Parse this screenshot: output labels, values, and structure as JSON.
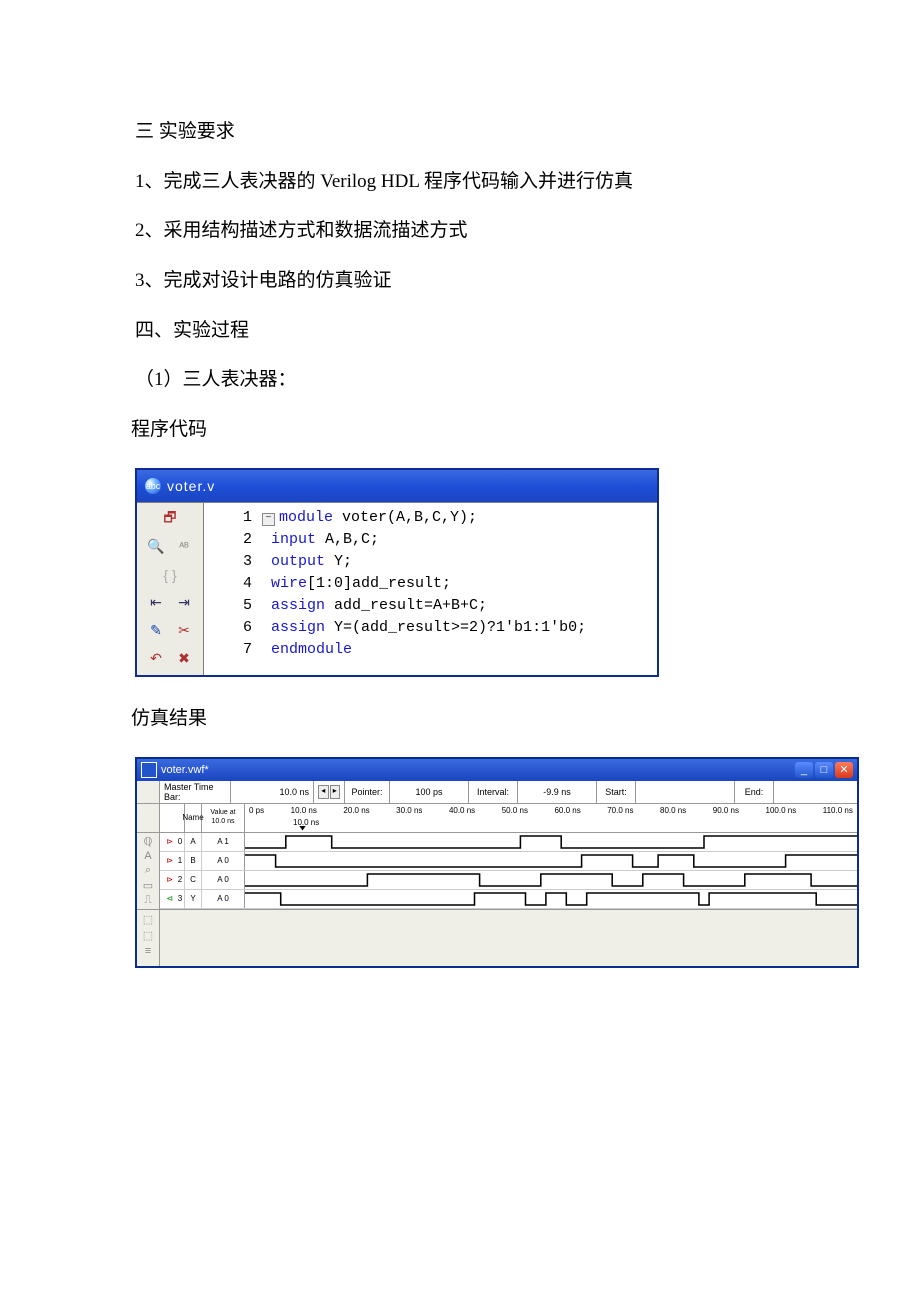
{
  "text": {
    "h_req": "三 实验要求",
    "req1": "1、完成三人表决器的 Verilog HDL 程序代码输入并进行仿真",
    "req2": "2、采用结构描述方式和数据流描述方式",
    "req3": "3、完成对设计电路的仿真验证",
    "h_proc": "四、实验过程",
    "proc1": "（1）三人表决器：",
    "code_label": "程序代码",
    "sim_label": "仿真结果"
  },
  "code_window": {
    "title": "voter.v",
    "icon_text": "abc",
    "lines": [
      {
        "n": "1",
        "kw": "module",
        "rest": " voter(A,B,C,Y);",
        "collapse": true
      },
      {
        "n": "2",
        "kw": "input",
        "rest": " A,B,C;"
      },
      {
        "n": "3",
        "kw": "output",
        "rest": " Y;"
      },
      {
        "n": "4",
        "kw": "wire",
        "rest": "[1:0]add_result;"
      },
      {
        "n": "5",
        "kw": "assign",
        "rest": " add_result=A+B+C;"
      },
      {
        "n": "6",
        "kw": "assign",
        "rest": " Y=(add_result>=2)?1'b1:1'b0;"
      },
      {
        "n": "7",
        "kw": "endmodule",
        "rest": ""
      }
    ]
  },
  "sim_window": {
    "title": "voter.vwf*",
    "toolbar": {
      "master_label": "Master Time Bar:",
      "master_value": "10.0 ns",
      "pointer_label": "Pointer:",
      "pointer_value": "100 ps",
      "interval_label": "Interval:",
      "interval_value": "-9.9 ns",
      "start_label": "Start:",
      "end_label": "End:"
    },
    "header": {
      "name": "Name",
      "value_at": "Value at",
      "value_time": "10.0 ns",
      "ticks": [
        "0 ps",
        "10.0 ns",
        "20.0 ns",
        "30.0 ns",
        "40.0 ns",
        "50.0 ns",
        "60.0 ns",
        "70.0 ns",
        "80.0 ns",
        "90.0 ns",
        "100.0 ns",
        "110.0 ns"
      ],
      "marker": "10.0 ns"
    },
    "signals": [
      {
        "idx": "0",
        "name": "A",
        "val": "A 1",
        "dir": "in"
      },
      {
        "idx": "1",
        "name": "B",
        "val": "A 0",
        "dir": "in"
      },
      {
        "idx": "2",
        "name": "C",
        "val": "A 0",
        "dir": "in"
      },
      {
        "idx": "3",
        "name": "Y",
        "val": "A 0",
        "dir": "out"
      }
    ]
  }
}
